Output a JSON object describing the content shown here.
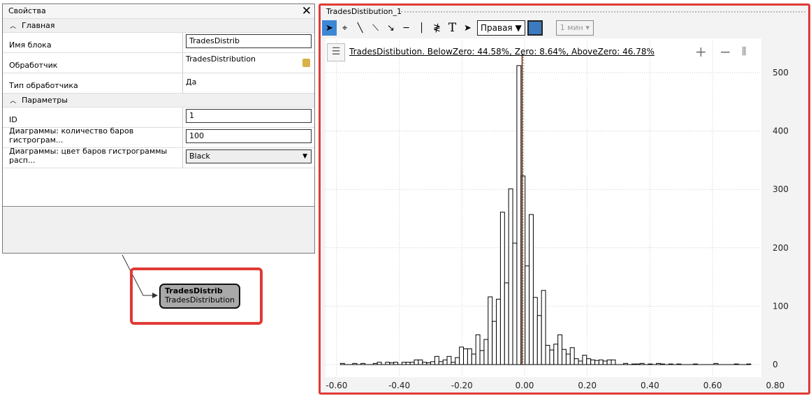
{
  "properties": {
    "title": "Свойства",
    "sections": [
      {
        "label": "Главная",
        "rows": [
          {
            "key": "Имя блока",
            "value": "TradesDistrib",
            "type": "input"
          },
          {
            "key": "Обработчик",
            "value": "TradesDistribution",
            "type": "locked"
          },
          {
            "key": "Тип обработчика",
            "value": "Да",
            "type": "text"
          }
        ]
      },
      {
        "label": "Параметры",
        "rows": [
          {
            "key": "ID",
            "value": "1",
            "type": "input"
          },
          {
            "key": "Диаграммы: количество баров гистрограм...",
            "value": "100",
            "type": "input"
          },
          {
            "key": "Диаграммы: цвет баров гистрограммы расп...",
            "value": "Black",
            "type": "select"
          }
        ]
      }
    ]
  },
  "node": {
    "name": "TradesDistrib",
    "handler": "TradesDistribution"
  },
  "chart_window": {
    "title": "TradesDistibution_1",
    "axis_side": "Правая",
    "timeframe": "1 мин",
    "color": "#3c7bbf",
    "legend": "TradesDistibution. BelowZero: 44.58%, Zero: 8.64%, AboveZero: 46.78%"
  },
  "chart_data": {
    "type": "bar",
    "title": "TradesDistibution. BelowZero: 44.58%, Zero: 8.64%, AboveZero: 46.78%",
    "bin_start": -0.588,
    "bin_width": 0.0131,
    "counts": [
      2,
      0,
      0,
      2,
      0,
      2,
      0,
      0,
      2,
      4,
      0,
      4,
      3,
      4,
      0,
      4,
      4,
      4,
      8,
      8,
      4,
      3,
      5,
      14,
      5,
      8,
      14,
      4,
      12,
      30,
      27,
      27,
      18,
      51,
      24,
      43,
      116,
      74,
      112,
      261,
      140,
      301,
      208,
      512,
      323,
      169,
      257,
      115,
      84,
      127,
      33,
      25,
      35,
      51,
      26,
      18,
      29,
      10,
      6,
      16,
      10,
      8,
      7,
      8,
      6,
      8,
      8,
      0,
      0,
      2,
      0,
      1,
      1,
      2,
      0,
      1,
      0,
      2,
      1,
      0,
      1,
      0,
      1,
      0,
      0,
      0,
      1,
      0,
      0,
      0,
      0,
      2,
      0,
      0,
      0,
      0,
      1,
      0,
      0,
      1
    ],
    "zero_line": -0.008,
    "xlim": [
      -0.64,
      0.8
    ],
    "ylim": [
      0,
      520
    ],
    "xticks": [
      "-0.60",
      "-0.40",
      "-0.20",
      "0.00",
      "0.20",
      "0.40",
      "0.60",
      "0.80"
    ],
    "yticks": [
      "0",
      "100",
      "200",
      "300",
      "400",
      "500"
    ],
    "grid": true
  }
}
